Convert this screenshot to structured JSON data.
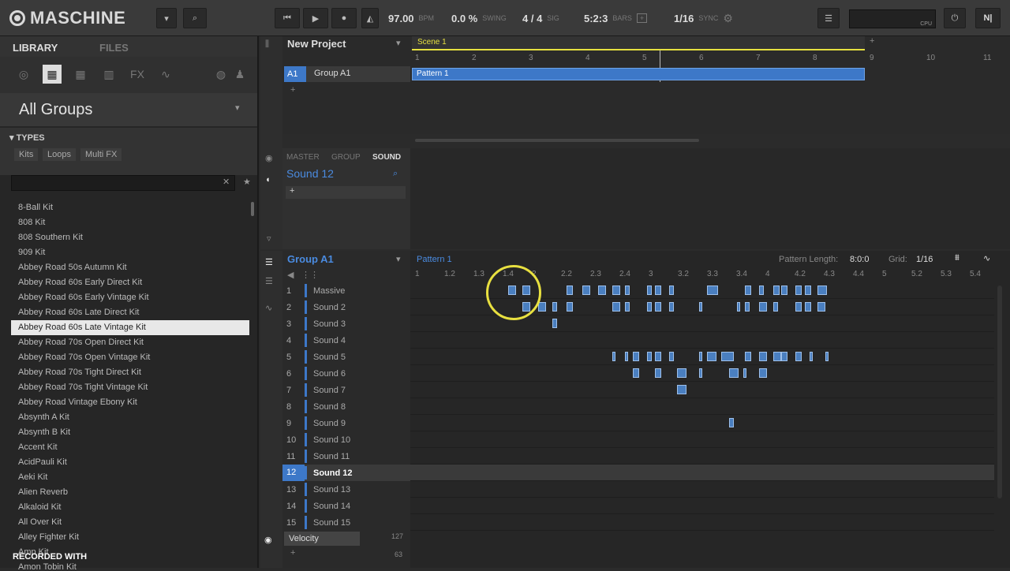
{
  "app": {
    "name": "MASCHINE"
  },
  "transport": {
    "tempo": "97.00",
    "tempo_unit": "BPM",
    "swing": "0.0 %",
    "swing_label": "SWING",
    "sig": "4 / 4",
    "sig_label": "SIG",
    "position": "5:2:3",
    "position_label": "BARS",
    "grid": "1/16",
    "grid_label": "SYNC",
    "cpu_label": "CPU"
  },
  "library": {
    "tab_library": "LIBRARY",
    "tab_files": "FILES",
    "group_title": "All Groups",
    "types_label": "TYPES",
    "types": [
      "Kits",
      "Loops",
      "Multi FX"
    ],
    "kits": [
      "8-Ball Kit",
      "808 Kit",
      "808 Southern Kit",
      "909 Kit",
      "Abbey Road 50s Autumn Kit",
      "Abbey Road 60s Early Direct Kit",
      "Abbey Road 60s Early Vintage Kit",
      "Abbey Road 60s Late Direct Kit",
      "Abbey Road 60s Late Vintage Kit",
      "Abbey Road 70s Open Direct Kit",
      "Abbey Road 70s Open Vintage Kit",
      "Abbey Road 70s Tight Direct Kit",
      "Abbey Road 70s Tight Vintage Kit",
      "Abbey Road Vintage Ebony Kit",
      "Absynth A Kit",
      "Absynth B Kit",
      "Accent Kit",
      "AcidPauli Kit",
      "Aeki Kit",
      "Alien Reverb",
      "Alkaloid Kit",
      "All Over Kit",
      "Alley Fighter Kit",
      "Amp Kit",
      "Amon Tobin Kit"
    ],
    "selected_index": 8
  },
  "arranger": {
    "project": "New Project",
    "scene": "Scene 1",
    "group_slot": "A1",
    "group_name": "Group A1",
    "pattern": "Pattern 1",
    "bars": [
      "1",
      "2",
      "3",
      "4",
      "5",
      "6",
      "7",
      "8",
      "9",
      "10",
      "11"
    ],
    "add": "+"
  },
  "mixer": {
    "tabs": [
      "MASTER",
      "GROUP",
      "SOUND"
    ],
    "sound_name": "Sound 12",
    "add": "+"
  },
  "pattern_editor": {
    "group": "Group A1",
    "pattern": "Pattern 1",
    "length_label": "Pattern Length:",
    "length": "8:0:0",
    "grid_label": "Grid:",
    "grid": "1/16",
    "ruler": [
      "1",
      "1.2",
      "1.3",
      "1.4",
      "2",
      "2.2",
      "2.3",
      "2.4",
      "3",
      "3.2",
      "3.3",
      "3.4",
      "4",
      "4.2",
      "4.3",
      "4.4",
      "5",
      "5.2",
      "5.3",
      "5.4"
    ],
    "sounds": [
      {
        "n": "1",
        "l": "Massive"
      },
      {
        "n": "2",
        "l": "Sound 2"
      },
      {
        "n": "3",
        "l": "Sound 3"
      },
      {
        "n": "4",
        "l": "Sound 4"
      },
      {
        "n": "5",
        "l": "Sound 5"
      },
      {
        "n": "6",
        "l": "Sound 6"
      },
      {
        "n": "7",
        "l": "Sound 7"
      },
      {
        "n": "8",
        "l": "Sound 8"
      },
      {
        "n": "9",
        "l": "Sound 9"
      },
      {
        "n": "10",
        "l": "Sound 10"
      },
      {
        "n": "11",
        "l": "Sound 11"
      },
      {
        "n": "12",
        "l": "Sound 12"
      },
      {
        "n": "13",
        "l": "Sound 13"
      },
      {
        "n": "14",
        "l": "Sound 14"
      },
      {
        "n": "15",
        "l": "Sound 15"
      }
    ],
    "selected_sound": 12,
    "velocity_label": "Velocity",
    "vel_max": "127",
    "vel_mid": "63"
  },
  "watermark": "RECORDED WITH"
}
